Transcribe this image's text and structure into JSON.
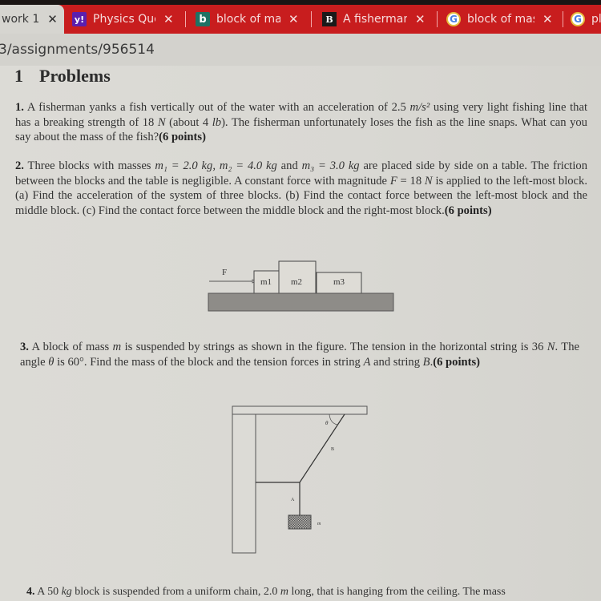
{
  "browser": {
    "tabs": [
      {
        "label": "work 1",
        "icon": "document-icon",
        "active": true
      },
      {
        "label": "Physics Ques",
        "icon": "yahoo-icon",
        "active": false
      },
      {
        "label": "block of mas",
        "icon": "bing-icon",
        "active": false
      },
      {
        "label": "A fisherman",
        "icon": "brainly-icon",
        "active": false
      },
      {
        "label": "block of mas",
        "icon": "google-icon",
        "active": false
      },
      {
        "label": "pl",
        "icon": "google-icon",
        "active": false
      }
    ],
    "close_glyph": "✕",
    "favicon_glyphs": {
      "yahoo": "y!",
      "bing": "b",
      "brainly": "B",
      "google": "G"
    },
    "url": "3/assignments/956514",
    "tab_color": "#c81d1e"
  },
  "document": {
    "section_number": "1",
    "section_title": "Problems",
    "problems": [
      {
        "number": "1.",
        "text_parts": [
          "A fisherman yanks a fish vertically out of the water with an acceleration of 2.5 ",
          "m/s²",
          " using very light fishing line that has a breaking strength of 18 ",
          "N",
          " (about 4 ",
          "lb",
          "). The fisherman unfortunately loses the fish as the line snaps. What can you say about the mass of the fish?"
        ],
        "points": "(6 points)"
      },
      {
        "number": "2.",
        "text_parts": [
          "Three blocks with masses ",
          "m₁ = 2.0 kg, m₂ = 4.0 kg",
          " and ",
          "m₃ = 3.0 kg",
          " are placed side by side on a table. The friction between the blocks and the table is negligible. A constant force with magnitude ",
          "F",
          " = 18 ",
          "N",
          " is applied to the left-most block. (a) Find the acceleration of the system of three blocks. (b) Find the contact force between the left-most block and the middle block. (c) Find the contact force between the middle block and the right-most block."
        ],
        "points": "(6 points)",
        "figure": {
          "force_label": "F",
          "blocks": [
            "m1",
            "m2",
            "m3"
          ]
        }
      },
      {
        "number": "3.",
        "text_parts": [
          "A block of mass ",
          "m",
          " is suspended by strings as shown in the figure. The tension in the horizontal string is 36 ",
          "N",
          ". The angle ",
          "θ",
          " is 60°. Find the mass of the block and the tension forces in string ",
          "A",
          " and string ",
          "B",
          "."
        ],
        "points": "(6 points)",
        "figure": {
          "angle_label": "θ",
          "string_labels": [
            "A",
            "B"
          ],
          "mass_label": "m"
        }
      },
      {
        "number": "4.",
        "text_parts": [
          "A 50 ",
          "kg",
          " block is suspended from a uniform chain, 2.0 ",
          "m",
          " long, that is hanging from the ceiling. The mass"
        ]
      }
    ]
  }
}
